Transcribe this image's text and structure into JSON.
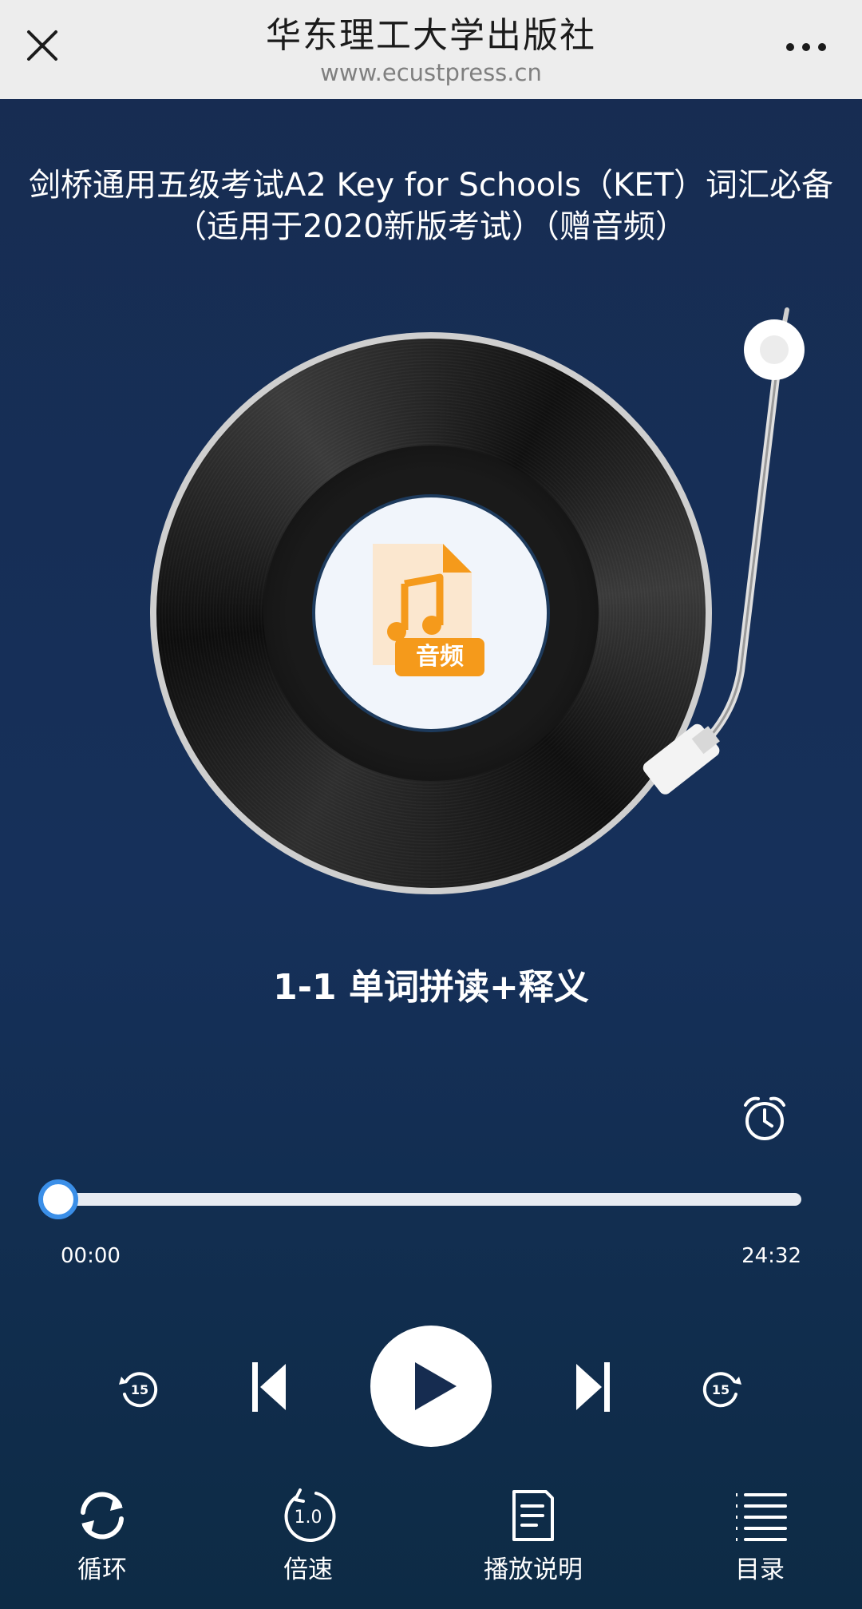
{
  "header": {
    "title": "华东理工大学出版社",
    "url": "www.ecustpress.cn",
    "close_icon": "close-icon",
    "more_icon": "more-icon"
  },
  "book": {
    "title_line1": "剑桥通用五级考试A2 Key for Schools（KET）词汇必备",
    "title_line2": "（适用于2020新版考试）（赠音频）"
  },
  "record": {
    "label_badge": "音频",
    "label_icon": "music-note-icon"
  },
  "track": {
    "title": "1-1 单词拼读+释义"
  },
  "player": {
    "current_time": "00:00",
    "total_time": "24:32",
    "progress": 0,
    "rewind_seconds": "15",
    "forward_seconds": "15",
    "timer_icon": "alarm-clock-icon",
    "accent_color": "#3b8fe8"
  },
  "bottom_bar": {
    "loop_label": "循环",
    "speed_label": "倍速",
    "speed_value": "1.0",
    "instructions_label": "播放说明",
    "catalog_label": "目录"
  }
}
